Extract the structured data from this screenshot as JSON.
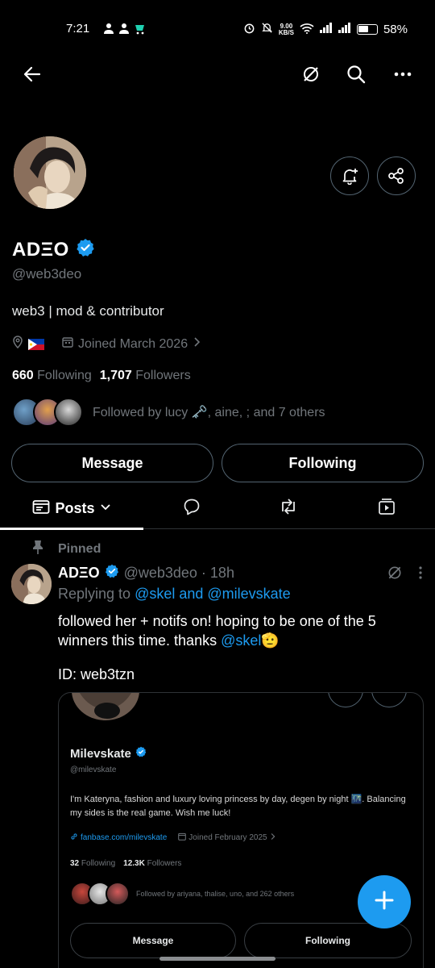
{
  "statusbar": {
    "time": "7:21",
    "net_speed_value": "9.00",
    "net_speed_unit": "KB/S",
    "battery": "58%",
    "battery_level": 0.58
  },
  "topbar": {
    "icons": [
      "back-arrow-icon",
      "grok-icon",
      "search-icon",
      "more-icon"
    ]
  },
  "profile": {
    "name": "ADΞO",
    "handle": "@web3deo",
    "bio": "web3 | mod & contributor",
    "joined": "Joined March 2026",
    "following_count": "660",
    "following_label": "Following",
    "followers_count": "1,707",
    "followers_label": "Followers",
    "followed_by": "Followed by lucy 🗝️, aine, ; and 7 others",
    "message_label": "Message",
    "following_button_label": "Following"
  },
  "tabs": [
    {
      "label": "Posts",
      "icon": "posts-icon",
      "active": true
    },
    {
      "label": "",
      "icon": "replies-icon"
    },
    {
      "label": "",
      "icon": "reposts-icon"
    },
    {
      "label": "",
      "icon": "media-icon"
    }
  ],
  "pinned_post": {
    "pinned_label": "Pinned",
    "name": "ADΞO",
    "handle_time": "@web3deo · 18h",
    "reply_prefix": "Replying to",
    "reply_targets": "@skel and @milevskate",
    "text_main": "followed her + notifs on! hoping to be one of the 5 winners this time.  thanks",
    "text_mention": "@skel",
    "text_emoji": "🫡",
    "id_line": "ID: web3tzn"
  },
  "embedded_card": {
    "name": "Milevskate",
    "handle": "@milevskate",
    "bio": "I'm Kateryna, fashion and luxury loving princess by day, degen by night 🌃. Balancing my sides is the real game. Wish me luck!",
    "link": "fanbase.com/milevskate",
    "joined": "Joined February 2025",
    "following_count": "32",
    "following_label": "Following",
    "followers_count": "12.3K",
    "followers_label": "Followers",
    "followed_by": "Followed by ariyana, thalise, uno, and 262 others",
    "message_label": "Message",
    "following_button_label": "Following"
  },
  "colors": {
    "background": "#000000",
    "accent": "#1d9bf0",
    "muted": "#71767b",
    "border": "#2f3336"
  }
}
